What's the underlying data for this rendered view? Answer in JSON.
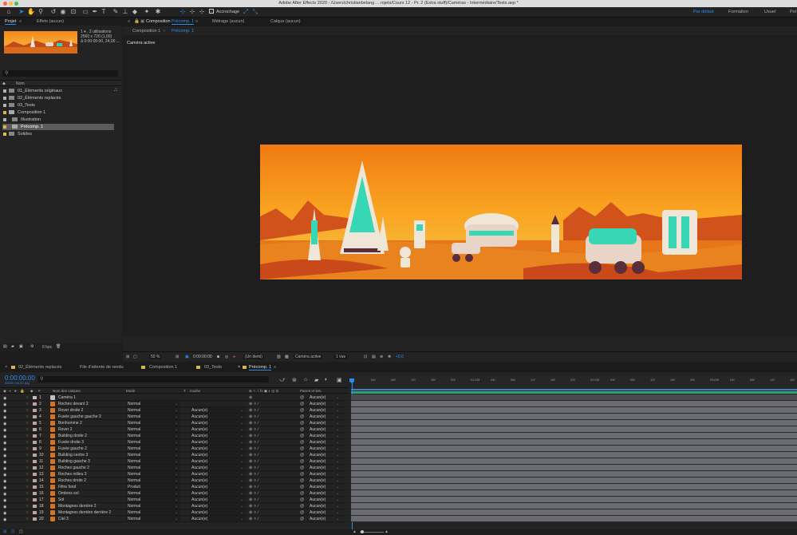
{
  "window": {
    "title": "Adobe After Effects 2020 - /Users/christianbelang ... rojets/Cours 12 - Pr. 2 (Extra stuff)/Caméras - Intermédiaire/Tests.aep *"
  },
  "toolbar": {
    "snap_label": "Accrochage"
  },
  "workspaces": [
    "Par défaut",
    "Formation",
    "Usuel",
    "Pet"
  ],
  "project_panel": {
    "tab_project": "Projet",
    "tab_effects": "Effets (aucun)",
    "footage_info": [
      "1 ▾ , 2 utilisations",
      "2560 x 720 (1,00)",
      "Δ 0:00:05:00, 24,00 ..."
    ],
    "column_name": "Nom",
    "items": [
      {
        "label": "01_Éléments originaux",
        "color": "#b4b4b4"
      },
      {
        "label": "02_Éléments replacés",
        "color": "#b4b4b4"
      },
      {
        "label": "03_Tests",
        "color": "#b4b4b4"
      },
      {
        "label": "Composition 1",
        "color": "#d8b44a"
      },
      {
        "label": "Illustration",
        "color": "#b4b4b4"
      },
      {
        "label": "Précomp. 1",
        "color": "#d8b44a"
      },
      {
        "label": "Solides",
        "color": "#d8c24a"
      }
    ],
    "bpc": "8 bpc"
  },
  "viewer": {
    "tab_comp": "Composition",
    "tab_comp_name": "Précomp. 1",
    "tab_footage": "Métrage (aucun)",
    "tab_layer": "Calque (aucun)",
    "crumb1": "Composition 1",
    "crumb2": "Précomp. 1",
    "active_camera": "Caméra active",
    "zoom": "50 %",
    "timecode": "0:00:00:00",
    "resolution": "(Un demi)",
    "camera_select": "Caméra active",
    "views": "1 vue",
    "exposure": "+0,0"
  },
  "timeline_tabs": [
    "02_Éléments replacés",
    "File d'attente de rendu",
    "Composition 1",
    "03_Tests",
    "Précomp. 1"
  ],
  "timeline": {
    "timecode": "0:00:00:00",
    "timecode_sub": "00000 (24.00 ips)",
    "columns": {
      "name": "Nom des calques",
      "mode": "Mode",
      "t": "T",
      "matte": "Cache",
      "parent": "Parent et lien"
    },
    "ruler_ticks": [
      "0f",
      "04f",
      "08f",
      "12f",
      "16f",
      "20f",
      "01:00f",
      "04f",
      "08f",
      "12f",
      "16f",
      "20f",
      "02:00f",
      "04f",
      "08f",
      "12f",
      "16f",
      "20f",
      "03:00f",
      "04f",
      "08f",
      "12f",
      "16f"
    ],
    "layers": [
      {
        "num": "1",
        "name": "Caméra 1",
        "mode": "",
        "matte": "",
        "parent": "Aucun(e)",
        "color": "#c0c0c0"
      },
      {
        "num": "2",
        "name": "Roches devant 3",
        "mode": "Normal",
        "matte": "",
        "parent": "Aucun(e)",
        "color": "#c0a0a0"
      },
      {
        "num": "3",
        "name": "Rover droite 2",
        "mode": "Normal",
        "matte": "Aucun(e)",
        "parent": "Aucun(e)",
        "color": "#c0a0a0"
      },
      {
        "num": "4",
        "name": "Fusée gauche gauche 3",
        "mode": "Normal",
        "matte": "Aucun(e)",
        "parent": "Aucun(e)",
        "color": "#c0a0a0"
      },
      {
        "num": "5",
        "name": "Bonhomme 2",
        "mode": "Normal",
        "matte": "Aucun(e)",
        "parent": "Aucun(e)",
        "color": "#c0a0a0"
      },
      {
        "num": "6",
        "name": "Rover 2",
        "mode": "Normal",
        "matte": "Aucun(e)",
        "parent": "Aucun(e)",
        "color": "#c0a0a0"
      },
      {
        "num": "7",
        "name": "Building droite 2",
        "mode": "Normal",
        "matte": "Aucun(e)",
        "parent": "Aucun(e)",
        "color": "#c0a0a0"
      },
      {
        "num": "8",
        "name": "Fusée droite 3",
        "mode": "Normal",
        "matte": "Aucun(e)",
        "parent": "Aucun(e)",
        "color": "#c0a0a0"
      },
      {
        "num": "9",
        "name": "Fusée gauche 2",
        "mode": "Normal",
        "matte": "Aucun(e)",
        "parent": "Aucun(e)",
        "color": "#c0a0a0"
      },
      {
        "num": "10",
        "name": "Building centre 3",
        "mode": "Normal",
        "matte": "Aucun(e)",
        "parent": "Aucun(e)",
        "color": "#c0a0a0"
      },
      {
        "num": "11",
        "name": "Building gauche 3",
        "mode": "Normal",
        "matte": "Aucun(e)",
        "parent": "Aucun(e)",
        "color": "#c0a0a0"
      },
      {
        "num": "12",
        "name": "Roches gauche 2",
        "mode": "Normal",
        "matte": "Aucun(e)",
        "parent": "Aucun(e)",
        "color": "#c0a0a0"
      },
      {
        "num": "13",
        "name": "Roches milieu 3",
        "mode": "Normal",
        "matte": "Aucun(e)",
        "parent": "Aucun(e)",
        "color": "#c0a0a0"
      },
      {
        "num": "14",
        "name": "Roches droite 2",
        "mode": "Normal",
        "matte": "Aucun(e)",
        "parent": "Aucun(e)",
        "color": "#c0a0a0"
      },
      {
        "num": "15",
        "name": "Filtre fond",
        "mode": "Produit",
        "matte": "Aucun(e)",
        "parent": "Aucun(e)",
        "color": "#c0a0a0"
      },
      {
        "num": "16",
        "name": "Ombres sol",
        "mode": "Normal",
        "matte": "Aucun(e)",
        "parent": "Aucun(e)",
        "color": "#c0a0a0"
      },
      {
        "num": "17",
        "name": "Sol",
        "mode": "Normal",
        "matte": "Aucun(e)",
        "parent": "Aucun(e)",
        "color": "#c0a0a0"
      },
      {
        "num": "18",
        "name": "Montagnes derrière 2",
        "mode": "Normal",
        "matte": "Aucun(e)",
        "parent": "Aucun(e)",
        "color": "#c0a0a0"
      },
      {
        "num": "19",
        "name": "Montagnes derrière derrière 2",
        "mode": "Normal",
        "matte": "Aucun(e)",
        "parent": "Aucun(e)",
        "color": "#c0a0a0"
      },
      {
        "num": "20",
        "name": "Ciel 3",
        "mode": "Normal",
        "matte": "Aucun(e)",
        "parent": "Aucun(e)",
        "color": "#c0a0a0"
      }
    ]
  },
  "colors": {
    "accent": "#2d8ceb",
    "track": "#6a6a73",
    "label_orange": "#d7751e"
  }
}
